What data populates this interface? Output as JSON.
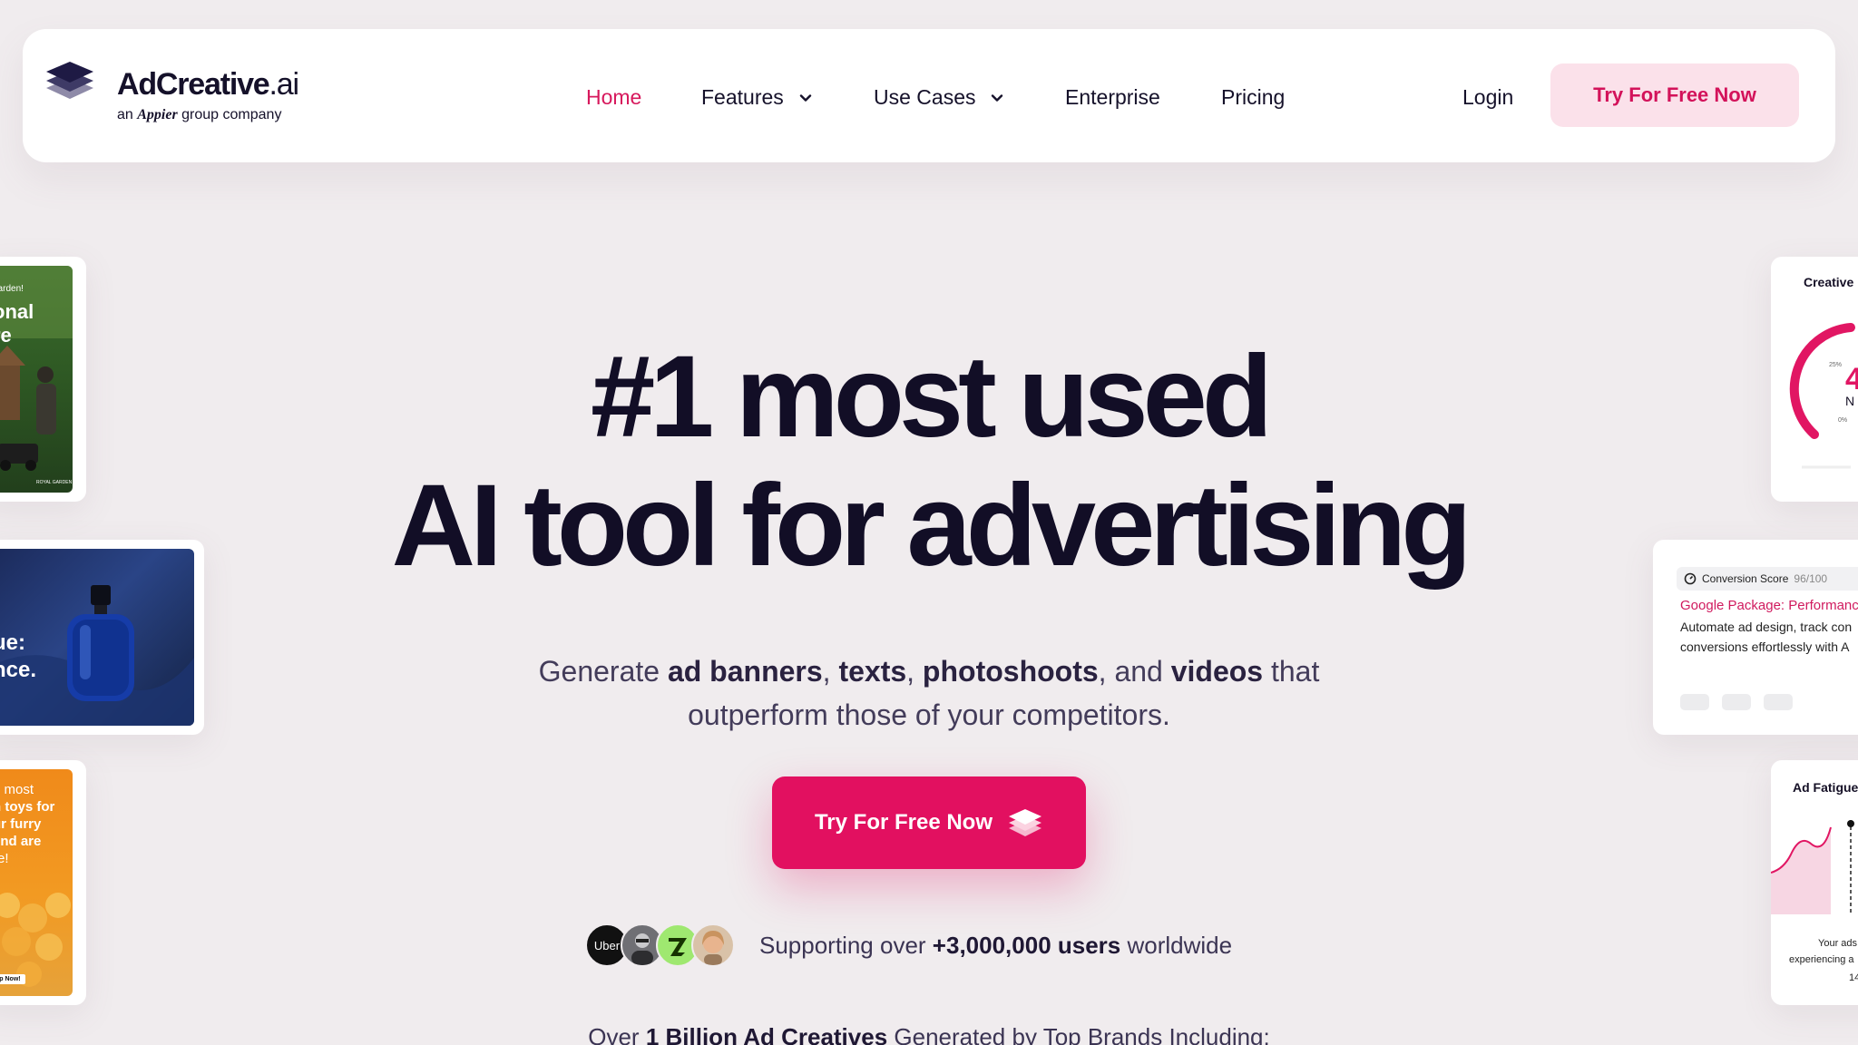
{
  "brand": {
    "name": "AdCreative",
    "suffix": ".ai",
    "tagline_pre": "an",
    "tagline_brand": "Appier",
    "tagline_post": "group company"
  },
  "nav": {
    "items": [
      {
        "label": "Home",
        "active": true
      },
      {
        "label": "Features",
        "dropdown": true
      },
      {
        "label": "Use Cases",
        "dropdown": true
      },
      {
        "label": "Enterprise"
      },
      {
        "label": "Pricing"
      }
    ],
    "login": "Login",
    "cta": "Try For Free Now"
  },
  "hero": {
    "title_line1": "#1 most used",
    "title_line2": "AI tool for advertising",
    "sub": {
      "t1": "Generate ",
      "b1": "ad banners",
      "t2": ", ",
      "b2": "texts",
      "t3": ", ",
      "b3": "photoshoots",
      "t4": ", and ",
      "b4": "videos",
      "t5": " that",
      "line2": "outperform those of your competitors."
    },
    "cta": "Try For Free Now"
  },
  "social_proof": {
    "avatar_label": "Uber",
    "text_pre": "Supporting over ",
    "text_bold": "+3,000,000 users",
    "text_post": " worldwide"
  },
  "brands_line": {
    "pre": "Over ",
    "bold": "1 Billion Ad Creatives",
    "post": " Generated by Top Brands Including:"
  },
  "left_cards": {
    "garden": {
      "small": "garden!",
      "big1": "onal",
      "big2": "re",
      "logo": "ROYAL GARDEN"
    },
    "perfume": {
      "line1": "ue:",
      "line2": "nce."
    },
    "pets": {
      "line1": "e most",
      "line2": "n toys for",
      "line3": "ur furry",
      "line4": "end are",
      "line5": "re!",
      "button": "op Now!"
    }
  },
  "right_cards": {
    "creative": {
      "title": "Creative",
      "gauge_value": "4",
      "gauge_label": "N",
      "tick_25": "25%",
      "tick_0": "0%"
    },
    "conversion": {
      "score_label": "Conversion Score",
      "score_value": "96/100",
      "heading": "Google Package: Performanc",
      "body1": "Automate ad design, track con",
      "body2": "conversions effortlessly with A"
    },
    "fatigue": {
      "title": "Ad Fatigue",
      "text1": "Your ads",
      "text2": "experiencing a",
      "text3": "14"
    }
  },
  "colors": {
    "accent": "#e21060",
    "accent_light": "#fbe1ea",
    "background": "#f0ecee",
    "text_dark": "#120e26"
  }
}
